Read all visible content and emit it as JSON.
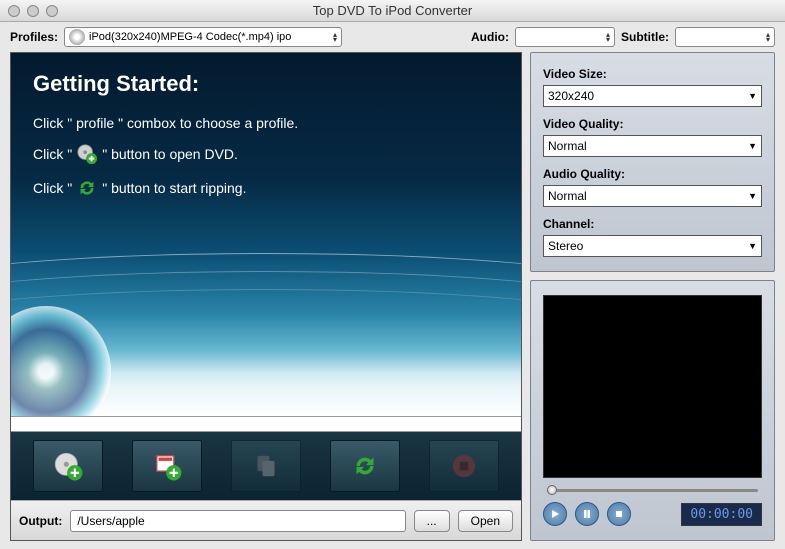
{
  "window": {
    "title": "Top DVD To iPod Converter"
  },
  "topbar": {
    "profiles_label": "Profiles:",
    "profiles_value": "iPod(320x240)MPEG-4 Codec(*.mp4) ipo",
    "audio_label": "Audio:",
    "audio_value": "",
    "subtitle_label": "Subtitle:",
    "subtitle_value": ""
  },
  "getting_started": {
    "heading": "Getting  Started:",
    "line1_a": "Click \" profile \" combox to choose a profile.",
    "line2_a": "Click \"",
    "line2_b": "\" button to open DVD.",
    "line3_a": "Click \"",
    "line3_b": "\" button to start ripping."
  },
  "toolbar": {
    "open_dvd": "open-dvd",
    "open_file": "open-file",
    "copy": "copy",
    "convert": "convert",
    "stop": "stop"
  },
  "output": {
    "label": "Output:",
    "path": "/Users/apple",
    "browse": "...",
    "open": "Open"
  },
  "settings": {
    "video_size_label": "Video Size:",
    "video_size_value": "320x240",
    "video_quality_label": "Video Quality:",
    "video_quality_value": "Normal",
    "audio_quality_label": "Audio Quality:",
    "audio_quality_value": "Normal",
    "channel_label": "Channel:",
    "channel_value": "Stereo"
  },
  "player": {
    "time": "00:00:00"
  }
}
